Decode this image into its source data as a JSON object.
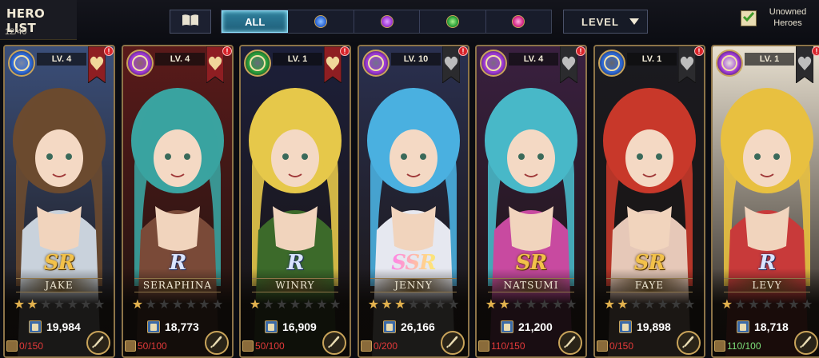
{
  "header": {
    "title": "HERO LIST",
    "count": "12/40"
  },
  "filters": {
    "tabs": [
      {
        "label": "ALL",
        "icon": "all-elements-icon",
        "active": true
      },
      {
        "label": "",
        "icon": "water-element-icon",
        "color": "#2f6ad8"
      },
      {
        "label": "",
        "icon": "dark-element-icon",
        "color": "#a03ad8"
      },
      {
        "label": "",
        "icon": "nature-element-icon",
        "color": "#2aa03a"
      },
      {
        "label": "",
        "icon": "fire-element-icon",
        "color": "#d82a8a"
      }
    ],
    "sort_label": "LEVEL",
    "unowned_label": "Unowned Heroes",
    "unowned_checked": true
  },
  "heroes": [
    {
      "name": "JAKE",
      "level": "LV. 4",
      "rarity": "SR",
      "stars": 2,
      "power": "19,984",
      "shards": "0/150",
      "element": "water",
      "element_color": "#2f6ad8",
      "favorite": true,
      "palette": [
        "#6b4a2f",
        "#c9d2dc",
        "#3b4f7a"
      ]
    },
    {
      "name": "SERAPHINA",
      "level": "LV. 4",
      "rarity": "R",
      "stars": 1,
      "power": "18,773",
      "shards": "50/100",
      "element": "dark",
      "element_color": "#a03ad8",
      "favorite": true,
      "palette": [
        "#3aa3a0",
        "#7a4a38",
        "#5a1a1a"
      ]
    },
    {
      "name": "WINRY",
      "level": "LV. 1",
      "rarity": "R",
      "stars": 1,
      "power": "16,909",
      "shards": "50/100",
      "element": "nature",
      "element_color": "#2aa03a",
      "favorite": true,
      "palette": [
        "#e6c84a",
        "#3c6a2a",
        "#1c1f3a"
      ]
    },
    {
      "name": "JENNY",
      "level": "LV. 10",
      "rarity": "SSR",
      "stars": 3,
      "power": "26,166",
      "shards": "0/200",
      "element": "dark",
      "element_color": "#a03ad8",
      "favorite": false,
      "palette": [
        "#4ab0e0",
        "#e6e8f0",
        "#2a3050"
      ]
    },
    {
      "name": "NATSUMI",
      "level": "LV. 4",
      "rarity": "SR",
      "stars": 2,
      "power": "21,200",
      "shards": "110/150",
      "element": "dark",
      "element_color": "#a03ad8",
      "favorite": false,
      "palette": [
        "#48b8c8",
        "#c84aa0",
        "#3a2040"
      ]
    },
    {
      "name": "FAYE",
      "level": "LV. 1",
      "rarity": "SR",
      "stars": 2,
      "power": "19,898",
      "shards": "0/150",
      "element": "water",
      "element_color": "#2f6ad8",
      "favorite": false,
      "palette": [
        "#c8382a",
        "#e6c8b8",
        "#1a1a20"
      ]
    },
    {
      "name": "LEVY",
      "level": "LV. 1",
      "rarity": "R",
      "stars": 1,
      "power": "18,718",
      "shards": "110/100",
      "element": "dark",
      "element_color": "#a03ad8",
      "favorite": false,
      "palette": [
        "#e8c040",
        "#c83a3a",
        "#e8e0d0"
      ]
    }
  ]
}
